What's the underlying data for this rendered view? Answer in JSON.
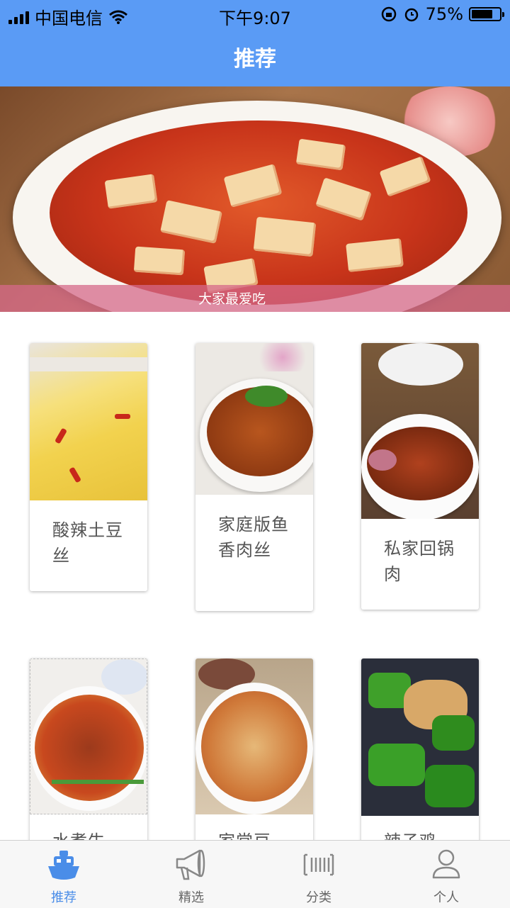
{
  "status_bar": {
    "carrier": "中国电信",
    "time": "下午9:07",
    "battery": "75%",
    "battery_level": 0.75,
    "icons": [
      "signal-icon",
      "wifi-icon",
      "orientation-lock-icon",
      "alarm-icon",
      "battery-icon"
    ]
  },
  "nav": {
    "title": "推荐"
  },
  "banner": {
    "caption": "大家最爱吃"
  },
  "cards": [
    {
      "name": "酸辣土豆丝"
    },
    {
      "name": "家庭版鱼香肉丝"
    },
    {
      "name": "私家回锅肉"
    },
    {
      "name": "水煮牛"
    },
    {
      "name": "家常豆"
    },
    {
      "name": "辣子鸡"
    }
  ],
  "tabs": [
    {
      "label": "推荐",
      "icon": "boat-icon",
      "active": true
    },
    {
      "label": "精选",
      "icon": "megaphone-icon",
      "active": false
    },
    {
      "label": "分类",
      "icon": "barcode-icon",
      "active": false
    },
    {
      "label": "个人",
      "icon": "person-icon",
      "active": false
    }
  ],
  "colors": {
    "accent": "#5a9bf5",
    "tab_active": "#4a8de8",
    "caption_bar": "#d6688a"
  }
}
